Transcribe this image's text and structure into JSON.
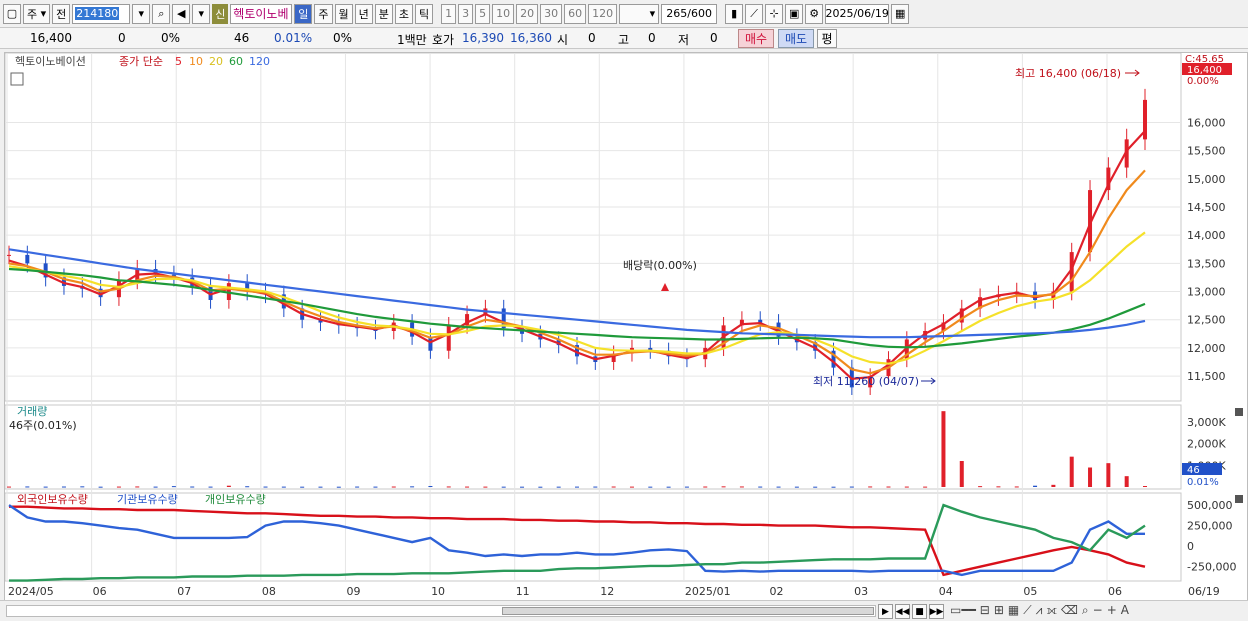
{
  "toolbar": {
    "market": "주",
    "prev_label": "전",
    "code": "214180",
    "new_badge": "신",
    "stock_name": "헥토이노베",
    "periods": [
      "일",
      "주",
      "월",
      "년",
      "분",
      "초",
      "틱"
    ],
    "active_period": "일",
    "intervals": [
      "1",
      "3",
      "5",
      "10",
      "20",
      "30",
      "60",
      "120"
    ],
    "count": "265",
    "count_total": "/600",
    "date": "2025/06/19"
  },
  "quote": {
    "price": "16,400",
    "change": "0",
    "change_pct": "0%",
    "volume": "46",
    "turnover_pct": "0.01%",
    "ratio": "0%",
    "unit": "1백만",
    "hoga_label": "호가",
    "ask": "16,390",
    "bid": "16,360",
    "open_label": "시",
    "open": "0",
    "high_label": "고",
    "high": "0",
    "low_label": "저",
    "low": "0",
    "buy_label": "매수",
    "sell_label": "매도",
    "even_label": "평"
  },
  "colors": {
    "up": "#e0202a",
    "down": "#2050c8",
    "ma5": "#e0202a",
    "ma10": "#f08a1c",
    "ma20": "#f5e12a",
    "ma60": "#1f9a3a",
    "ma120": "#3a6ae0"
  },
  "price_panel": {
    "legend_name": "헥토이노베이션",
    "legend_ma": "종가 단순",
    "ma_periods": [
      "5",
      "10",
      "20",
      "60",
      "120"
    ],
    "high_annotation": "최고 16,400 (06/18)",
    "low_annotation": "최저 11,260 (04/07)",
    "dividend_annotation": "배당락(0.00%)",
    "right_top": "C:45.65",
    "price_tag": "16,400",
    "pct_tag": "0.00%",
    "y_ticks": [
      "16,000",
      "15,500",
      "15,000",
      "14,500",
      "14,000",
      "13,500",
      "13,000",
      "12,500",
      "12,000",
      "11,500"
    ]
  },
  "volume_panel": {
    "title": "거래량",
    "value_label": "46주(0.01%)",
    "y_ticks": [
      "3,000K",
      "2,000K",
      "1,000K"
    ],
    "tag": "46",
    "tag_pct": "0.01%"
  },
  "holdings_panel": {
    "legend": [
      "외국인보유수량",
      "기관보유수량",
      "개인보유수량"
    ],
    "y_ticks": [
      "500,000",
      "250,000",
      "0",
      "-250,000"
    ]
  },
  "x_axis": [
    "2024/05",
    "06",
    "07",
    "08",
    "09",
    "10",
    "11",
    "12",
    "2025/01",
    "02",
    "03",
    "04",
    "05",
    "06",
    "06/19"
  ],
  "chart_data": [
    {
      "type": "candlestick",
      "title": "헥토이노베이션",
      "series": [
        {
          "name": "종가",
          "values": [
            13650,
            13500,
            13250,
            13100,
            13050,
            12900,
            13200,
            13400,
            13300,
            13250,
            13100,
            12850,
            13150,
            13000,
            12950,
            12700,
            12500,
            12450,
            12400,
            12350,
            12300,
            12450,
            12200,
            11950,
            12400,
            12600,
            12700,
            12350,
            12250,
            12150,
            12050,
            11850,
            11750,
            11900,
            12000,
            11950,
            11850,
            11800,
            12000,
            12400,
            12500,
            12450,
            12200,
            12100,
            11950,
            11650,
            11300,
            11500,
            11800,
            12150,
            12300,
            12450,
            12700,
            12900,
            12950,
            13000,
            12850,
            13000,
            13700,
            14800,
            15200,
            15700,
            16400
          ]
        },
        {
          "name": "5",
          "values": [
            13550,
            13450,
            13300,
            13150,
            13080,
            12950,
            13100,
            13300,
            13320,
            13250,
            13150,
            12950,
            13050,
            13020,
            12960,
            12780,
            12600,
            12500,
            12420,
            12380,
            12330,
            12400,
            12280,
            12100,
            12250,
            12450,
            12600,
            12450,
            12330,
            12200,
            12080,
            11920,
            11800,
            11860,
            11940,
            11950,
            11880,
            11820,
            11920,
            12200,
            12420,
            12440,
            12300,
            12150,
            12000,
            11750,
            11450,
            11480,
            11700,
            12000,
            12250,
            12420,
            12650,
            12850,
            12930,
            12980,
            12900,
            12960,
            13400,
            14200,
            14900,
            15500,
            15850
          ]
        },
        {
          "name": "10",
          "values": [
            13500,
            13450,
            13350,
            13220,
            13150,
            13000,
            13050,
            13200,
            13280,
            13260,
            13180,
            13020,
            13050,
            13010,
            12980,
            12820,
            12680,
            12560,
            12460,
            12400,
            12350,
            12380,
            12300,
            12180,
            12230,
            12380,
            12500,
            12450,
            12380,
            12270,
            12150,
            12000,
            11880,
            11880,
            11920,
            11940,
            11900,
            11860,
            11900,
            12080,
            12300,
            12400,
            12350,
            12220,
            12080,
            11880,
            11620,
            11550,
            11650,
            11880,
            12100,
            12300,
            12520,
            12720,
            12850,
            12930,
            12920,
            12950,
            13200,
            13700,
            14300,
            14800,
            15150
          ]
        },
        {
          "name": "20",
          "values": [
            13450,
            13400,
            13350,
            13280,
            13220,
            13120,
            13080,
            13150,
            13220,
            13230,
            13200,
            13100,
            13070,
            13040,
            13000,
            12900,
            12780,
            12650,
            12540,
            12460,
            12400,
            12380,
            12330,
            12250,
            12240,
            12300,
            12380,
            12400,
            12380,
            12320,
            12230,
            12120,
            12000,
            11960,
            11950,
            11950,
            11930,
            11900,
            11900,
            11990,
            12120,
            12240,
            12280,
            12240,
            12150,
            12020,
            11850,
            11750,
            11720,
            11800,
            11950,
            12120,
            12300,
            12480,
            12620,
            12740,
            12820,
            12870,
            12980,
            13200,
            13500,
            13800,
            14050
          ]
        },
        {
          "name": "60",
          "values": [
            13400,
            13380,
            13350,
            13320,
            13290,
            13250,
            13200,
            13180,
            13150,
            13120,
            13080,
            13030,
            12980,
            12930,
            12880,
            12830,
            12780,
            12720,
            12660,
            12600,
            12550,
            12510,
            12470,
            12430,
            12400,
            12370,
            12350,
            12330,
            12310,
            12290,
            12270,
            12250,
            12230,
            12210,
            12190,
            12180,
            12170,
            12160,
            12150,
            12150,
            12160,
            12170,
            12180,
            12180,
            12170,
            12150,
            12100,
            12050,
            12020,
            12010,
            12020,
            12050,
            12080,
            12120,
            12160,
            12200,
            12230,
            12270,
            12330,
            12410,
            12520,
            12650,
            12780
          ]
        },
        {
          "name": "120",
          "values": [
            13750,
            13700,
            13650,
            13600,
            13550,
            13500,
            13450,
            13400,
            13360,
            13320,
            13280,
            13240,
            13200,
            13160,
            13120,
            13080,
            13040,
            13000,
            12960,
            12920,
            12880,
            12840,
            12800,
            12760,
            12720,
            12680,
            12650,
            12620,
            12590,
            12560,
            12530,
            12500,
            12470,
            12440,
            12410,
            12380,
            12350,
            12320,
            12300,
            12280,
            12260,
            12250,
            12240,
            12230,
            12220,
            12210,
            12200,
            12190,
            12190,
            12190,
            12200,
            12210,
            12220,
            12230,
            12240,
            12250,
            12260,
            12270,
            12290,
            12320,
            12360,
            12410,
            12480
          ]
        }
      ],
      "ylim": [
        11200,
        16700
      ]
    },
    {
      "type": "bar",
      "title": "거래량",
      "values": [
        20,
        25,
        18,
        22,
        30,
        15,
        20,
        25,
        18,
        40,
        22,
        18,
        60,
        35,
        20,
        18,
        15,
        16,
        14,
        20,
        18,
        22,
        30,
        45,
        25,
        20,
        18,
        16,
        15,
        14,
        16,
        18,
        20,
        22,
        18,
        16,
        15,
        18,
        22,
        30,
        25,
        20,
        18,
        16,
        15,
        14,
        20,
        25,
        22,
        20,
        18,
        3500,
        1200,
        40,
        30,
        25,
        60,
        100,
        1400,
        900,
        1100,
        500,
        46
      ],
      "ylim": [
        0,
        3600000
      ]
    },
    {
      "type": "line",
      "title": "보유수량",
      "series": [
        {
          "name": "외국인보유수량",
          "values": [
            480000,
            480000,
            470000,
            460000,
            460000,
            450000,
            450000,
            440000,
            440000,
            440000,
            430000,
            420000,
            410000,
            400000,
            400000,
            390000,
            380000,
            370000,
            370000,
            360000,
            360000,
            350000,
            350000,
            340000,
            340000,
            330000,
            330000,
            330000,
            320000,
            320000,
            310000,
            310000,
            300000,
            300000,
            290000,
            290000,
            280000,
            280000,
            270000,
            270000,
            260000,
            260000,
            250000,
            250000,
            250000,
            240000,
            230000,
            230000,
            220000,
            210000,
            200000,
            -350000,
            -300000,
            -250000,
            -200000,
            -150000,
            -100000,
            -50000,
            -10000,
            -50000,
            -100000,
            -200000,
            -250000
          ]
        },
        {
          "name": "기관보유수량",
          "values": [
            500000,
            350000,
            300000,
            300000,
            280000,
            250000,
            220000,
            200000,
            150000,
            100000,
            100000,
            100000,
            100000,
            110000,
            250000,
            300000,
            300000,
            280000,
            250000,
            200000,
            150000,
            100000,
            50000,
            100000,
            -50000,
            -80000,
            -120000,
            -100000,
            -120000,
            -100000,
            -100000,
            -80000,
            -100000,
            -100000,
            -80000,
            -50000,
            -40000,
            -60000,
            -300000,
            -310000,
            -300000,
            -310000,
            -300000,
            -300000,
            -300000,
            -300000,
            -300000,
            -310000,
            -300000,
            -300000,
            -300000,
            -300000,
            -350000,
            -300000,
            -300000,
            -300000,
            -300000,
            -300000,
            -200000,
            200000,
            300000,
            150000,
            150000
          ]
        },
        {
          "name": "개인보유수량",
          "values": [
            -420000,
            -420000,
            -410000,
            -400000,
            -400000,
            -390000,
            -390000,
            -380000,
            -380000,
            -380000,
            -370000,
            -370000,
            -370000,
            -360000,
            -360000,
            -360000,
            -350000,
            -350000,
            -350000,
            -340000,
            -340000,
            -340000,
            -330000,
            -330000,
            -330000,
            -320000,
            -310000,
            -300000,
            -300000,
            -300000,
            -280000,
            -270000,
            -270000,
            -260000,
            -250000,
            -240000,
            -240000,
            -230000,
            -220000,
            -220000,
            -200000,
            -200000,
            -190000,
            -180000,
            -170000,
            -160000,
            -160000,
            -160000,
            -150000,
            -150000,
            -150000,
            500000,
            420000,
            350000,
            300000,
            250000,
            200000,
            100000,
            50000,
            -50000,
            200000,
            100000,
            250000
          ]
        }
      ],
      "ylim": [
        -400000,
        550000
      ]
    }
  ]
}
